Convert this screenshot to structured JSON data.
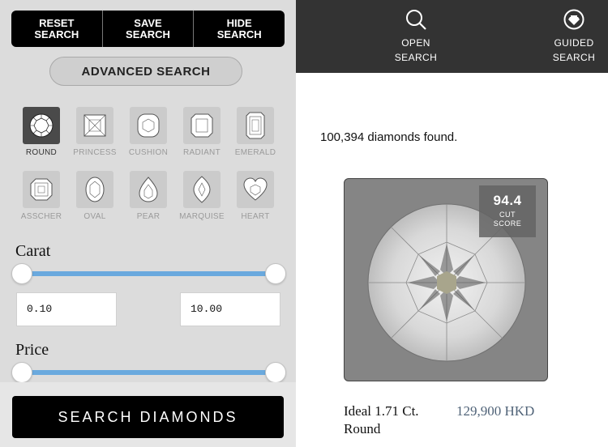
{
  "filters": {
    "top_buttons": {
      "reset": "RESET\nSEARCH",
      "save": "SAVE\nSEARCH",
      "hide": "HIDE\nSEARCH"
    },
    "advanced_search": "ADVANCED SEARCH",
    "shapes": [
      {
        "label": "ROUND",
        "icon": "round-icon",
        "selected": true
      },
      {
        "label": "PRINCESS",
        "icon": "princess-icon",
        "selected": false
      },
      {
        "label": "CUSHION",
        "icon": "cushion-icon",
        "selected": false
      },
      {
        "label": "RADIANT",
        "icon": "radiant-icon",
        "selected": false
      },
      {
        "label": "EMERALD",
        "icon": "emerald-icon",
        "selected": false
      },
      {
        "label": "ASSCHER",
        "icon": "asscher-icon",
        "selected": false
      },
      {
        "label": "OVAL",
        "icon": "oval-icon",
        "selected": false
      },
      {
        "label": "PEAR",
        "icon": "pear-icon",
        "selected": false
      },
      {
        "label": "MARQUISE",
        "icon": "marquise-icon",
        "selected": false
      },
      {
        "label": "HEART",
        "icon": "heart-icon",
        "selected": false
      }
    ],
    "carat": {
      "label": "Carat",
      "min": "0.10",
      "max": "10.00"
    },
    "price": {
      "label": "Price"
    },
    "search_button": "SEARCH DIAMONDS"
  },
  "nav": {
    "open_search": "OPEN\nSEARCH",
    "guided_search": "GUIDED\nSEARCH"
  },
  "results": {
    "count_text": "100,394 diamonds found.",
    "item": {
      "cut_score": "94.4",
      "cut_score_label": "CUT\nSCORE",
      "name": "Ideal 1.71 Ct. Round",
      "price": "129,900 HKD"
    }
  },
  "colors": {
    "accent": "#6aa9de",
    "dark": "#333333",
    "price": "#506378"
  }
}
